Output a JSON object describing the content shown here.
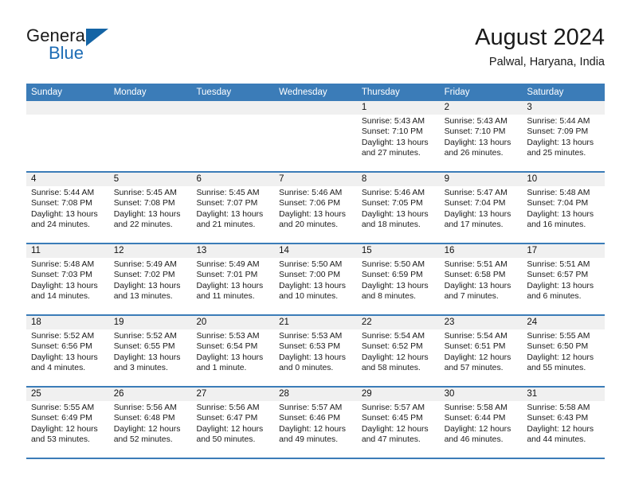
{
  "brand": {
    "name_top": "General",
    "name_bottom": "Blue",
    "accent_color": "#1464a5",
    "text_color": "#1a1a1a"
  },
  "header": {
    "title": "August 2024",
    "location": "Palwal, Haryana, India"
  },
  "theme": {
    "header_band": "#3b7cb8",
    "daynum_band": "#f0f0f0",
    "cell_background": "#ffffff",
    "row_divider": "#3b7cb8"
  },
  "weekdays": [
    "Sunday",
    "Monday",
    "Tuesday",
    "Wednesday",
    "Thursday",
    "Friday",
    "Saturday"
  ],
  "weeks": [
    [
      {
        "day": "",
        "sunrise": "",
        "sunset": "",
        "daylight_line1": "",
        "daylight_line2": "",
        "empty": true
      },
      {
        "day": "",
        "sunrise": "",
        "sunset": "",
        "daylight_line1": "",
        "daylight_line2": "",
        "empty": true
      },
      {
        "day": "",
        "sunrise": "",
        "sunset": "",
        "daylight_line1": "",
        "daylight_line2": "",
        "empty": true
      },
      {
        "day": "",
        "sunrise": "",
        "sunset": "",
        "daylight_line1": "",
        "daylight_line2": "",
        "empty": true
      },
      {
        "day": "1",
        "sunrise": "Sunrise: 5:43 AM",
        "sunset": "Sunset: 7:10 PM",
        "daylight_line1": "Daylight: 13 hours",
        "daylight_line2": "and 27 minutes."
      },
      {
        "day": "2",
        "sunrise": "Sunrise: 5:43 AM",
        "sunset": "Sunset: 7:10 PM",
        "daylight_line1": "Daylight: 13 hours",
        "daylight_line2": "and 26 minutes."
      },
      {
        "day": "3",
        "sunrise": "Sunrise: 5:44 AM",
        "sunset": "Sunset: 7:09 PM",
        "daylight_line1": "Daylight: 13 hours",
        "daylight_line2": "and 25 minutes."
      }
    ],
    [
      {
        "day": "4",
        "sunrise": "Sunrise: 5:44 AM",
        "sunset": "Sunset: 7:08 PM",
        "daylight_line1": "Daylight: 13 hours",
        "daylight_line2": "and 24 minutes."
      },
      {
        "day": "5",
        "sunrise": "Sunrise: 5:45 AM",
        "sunset": "Sunset: 7:08 PM",
        "daylight_line1": "Daylight: 13 hours",
        "daylight_line2": "and 22 minutes."
      },
      {
        "day": "6",
        "sunrise": "Sunrise: 5:45 AM",
        "sunset": "Sunset: 7:07 PM",
        "daylight_line1": "Daylight: 13 hours",
        "daylight_line2": "and 21 minutes."
      },
      {
        "day": "7",
        "sunrise": "Sunrise: 5:46 AM",
        "sunset": "Sunset: 7:06 PM",
        "daylight_line1": "Daylight: 13 hours",
        "daylight_line2": "and 20 minutes."
      },
      {
        "day": "8",
        "sunrise": "Sunrise: 5:46 AM",
        "sunset": "Sunset: 7:05 PM",
        "daylight_line1": "Daylight: 13 hours",
        "daylight_line2": "and 18 minutes."
      },
      {
        "day": "9",
        "sunrise": "Sunrise: 5:47 AM",
        "sunset": "Sunset: 7:04 PM",
        "daylight_line1": "Daylight: 13 hours",
        "daylight_line2": "and 17 minutes."
      },
      {
        "day": "10",
        "sunrise": "Sunrise: 5:48 AM",
        "sunset": "Sunset: 7:04 PM",
        "daylight_line1": "Daylight: 13 hours",
        "daylight_line2": "and 16 minutes."
      }
    ],
    [
      {
        "day": "11",
        "sunrise": "Sunrise: 5:48 AM",
        "sunset": "Sunset: 7:03 PM",
        "daylight_line1": "Daylight: 13 hours",
        "daylight_line2": "and 14 minutes."
      },
      {
        "day": "12",
        "sunrise": "Sunrise: 5:49 AM",
        "sunset": "Sunset: 7:02 PM",
        "daylight_line1": "Daylight: 13 hours",
        "daylight_line2": "and 13 minutes."
      },
      {
        "day": "13",
        "sunrise": "Sunrise: 5:49 AM",
        "sunset": "Sunset: 7:01 PM",
        "daylight_line1": "Daylight: 13 hours",
        "daylight_line2": "and 11 minutes."
      },
      {
        "day": "14",
        "sunrise": "Sunrise: 5:50 AM",
        "sunset": "Sunset: 7:00 PM",
        "daylight_line1": "Daylight: 13 hours",
        "daylight_line2": "and 10 minutes."
      },
      {
        "day": "15",
        "sunrise": "Sunrise: 5:50 AM",
        "sunset": "Sunset: 6:59 PM",
        "daylight_line1": "Daylight: 13 hours",
        "daylight_line2": "and 8 minutes."
      },
      {
        "day": "16",
        "sunrise": "Sunrise: 5:51 AM",
        "sunset": "Sunset: 6:58 PM",
        "daylight_line1": "Daylight: 13 hours",
        "daylight_line2": "and 7 minutes."
      },
      {
        "day": "17",
        "sunrise": "Sunrise: 5:51 AM",
        "sunset": "Sunset: 6:57 PM",
        "daylight_line1": "Daylight: 13 hours",
        "daylight_line2": "and 6 minutes."
      }
    ],
    [
      {
        "day": "18",
        "sunrise": "Sunrise: 5:52 AM",
        "sunset": "Sunset: 6:56 PM",
        "daylight_line1": "Daylight: 13 hours",
        "daylight_line2": "and 4 minutes."
      },
      {
        "day": "19",
        "sunrise": "Sunrise: 5:52 AM",
        "sunset": "Sunset: 6:55 PM",
        "daylight_line1": "Daylight: 13 hours",
        "daylight_line2": "and 3 minutes."
      },
      {
        "day": "20",
        "sunrise": "Sunrise: 5:53 AM",
        "sunset": "Sunset: 6:54 PM",
        "daylight_line1": "Daylight: 13 hours",
        "daylight_line2": "and 1 minute."
      },
      {
        "day": "21",
        "sunrise": "Sunrise: 5:53 AM",
        "sunset": "Sunset: 6:53 PM",
        "daylight_line1": "Daylight: 13 hours",
        "daylight_line2": "and 0 minutes."
      },
      {
        "day": "22",
        "sunrise": "Sunrise: 5:54 AM",
        "sunset": "Sunset: 6:52 PM",
        "daylight_line1": "Daylight: 12 hours",
        "daylight_line2": "and 58 minutes."
      },
      {
        "day": "23",
        "sunrise": "Sunrise: 5:54 AM",
        "sunset": "Sunset: 6:51 PM",
        "daylight_line1": "Daylight: 12 hours",
        "daylight_line2": "and 57 minutes."
      },
      {
        "day": "24",
        "sunrise": "Sunrise: 5:55 AM",
        "sunset": "Sunset: 6:50 PM",
        "daylight_line1": "Daylight: 12 hours",
        "daylight_line2": "and 55 minutes."
      }
    ],
    [
      {
        "day": "25",
        "sunrise": "Sunrise: 5:55 AM",
        "sunset": "Sunset: 6:49 PM",
        "daylight_line1": "Daylight: 12 hours",
        "daylight_line2": "and 53 minutes."
      },
      {
        "day": "26",
        "sunrise": "Sunrise: 5:56 AM",
        "sunset": "Sunset: 6:48 PM",
        "daylight_line1": "Daylight: 12 hours",
        "daylight_line2": "and 52 minutes."
      },
      {
        "day": "27",
        "sunrise": "Sunrise: 5:56 AM",
        "sunset": "Sunset: 6:47 PM",
        "daylight_line1": "Daylight: 12 hours",
        "daylight_line2": "and 50 minutes."
      },
      {
        "day": "28",
        "sunrise": "Sunrise: 5:57 AM",
        "sunset": "Sunset: 6:46 PM",
        "daylight_line1": "Daylight: 12 hours",
        "daylight_line2": "and 49 minutes."
      },
      {
        "day": "29",
        "sunrise": "Sunrise: 5:57 AM",
        "sunset": "Sunset: 6:45 PM",
        "daylight_line1": "Daylight: 12 hours",
        "daylight_line2": "and 47 minutes."
      },
      {
        "day": "30",
        "sunrise": "Sunrise: 5:58 AM",
        "sunset": "Sunset: 6:44 PM",
        "daylight_line1": "Daylight: 12 hours",
        "daylight_line2": "and 46 minutes."
      },
      {
        "day": "31",
        "sunrise": "Sunrise: 5:58 AM",
        "sunset": "Sunset: 6:43 PM",
        "daylight_line1": "Daylight: 12 hours",
        "daylight_line2": "and 44 minutes."
      }
    ]
  ]
}
